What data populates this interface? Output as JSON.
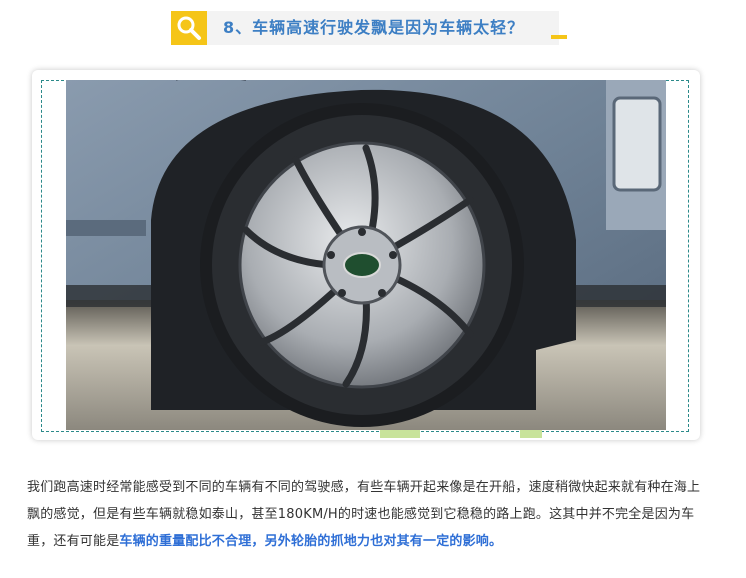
{
  "heading": {
    "title": "8、车辆高速行驶发飘是因为车辆太轻？"
  },
  "image": {
    "alt": "Alloy wheel and tyre of a grey-blue SUV on sandy ground"
  },
  "paragraph": {
    "part1": "我们跑高速时经常能感受到不同的车辆有不同的驾驶感，有些车辆开起来像是在开船，速度稍微快起来就有种在海上飘的感觉，但是有些车辆就稳如泰山，甚至180KM/H的时速也能感觉到它稳稳的路上跑。这其中并不完全是因为车重，还有可能是",
    "highlight": "车辆的重量配比不合理，另外轮胎的抓地力也对其有一定的影响。"
  },
  "colors": {
    "accent_yellow": "#f5c518",
    "title_blue": "#3d7fc4",
    "highlight_blue": "#2f6fd6",
    "frame_teal": "#2b8a8a"
  }
}
